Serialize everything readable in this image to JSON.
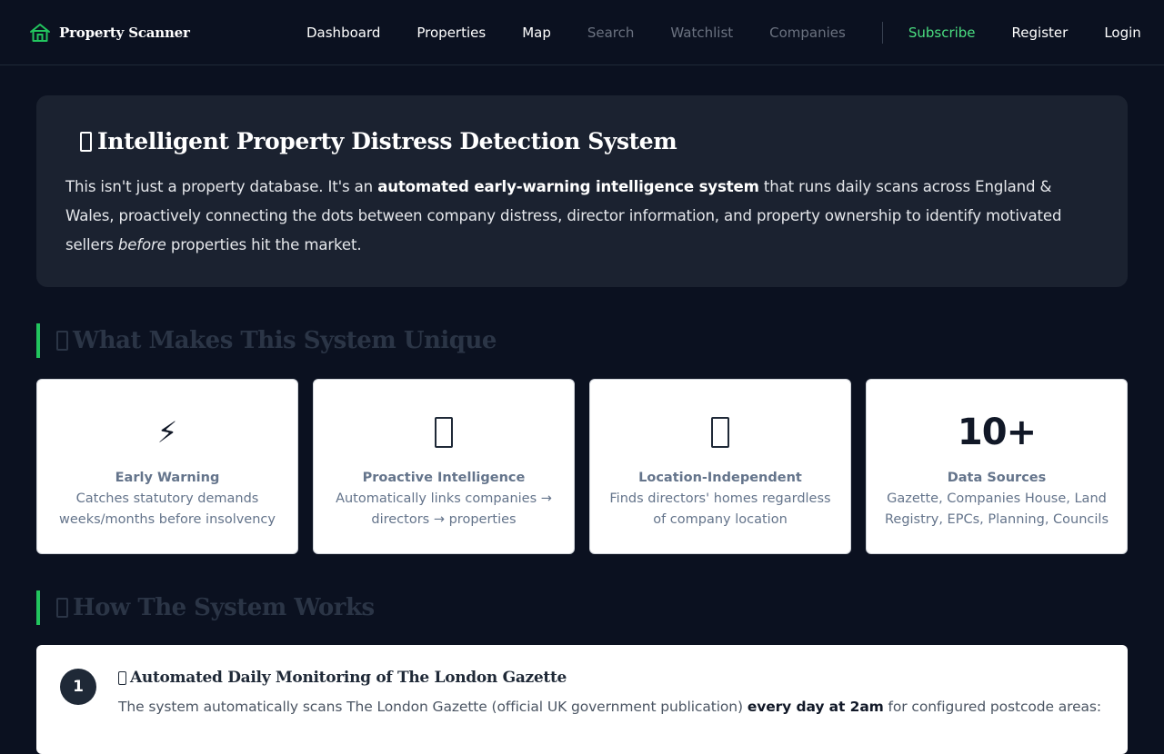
{
  "nav": {
    "brand": "Property Scanner",
    "brand_icon": "house-icon",
    "links": [
      {
        "label": "Dashboard"
      },
      {
        "label": "Properties"
      },
      {
        "label": "Map"
      },
      {
        "label": "Search"
      },
      {
        "label": "Watchlist"
      },
      {
        "label": "Companies"
      }
    ],
    "subscribe": "Subscribe",
    "register": "Register",
    "login": "Login"
  },
  "hero": {
    "title": "Intelligent Property Distress Detection System",
    "text_1": "This isn't just a property database. It's an ",
    "text_bold": "automated early-warning intelligence system",
    "text_2": " that runs daily scans across England & Wales, proactively connecting the dots between company distress, director information, and property ownership to identify motivated sellers ",
    "text_em": "before",
    "text_3": " properties hit the market."
  },
  "sections": {
    "unique": "What Makes This System Unique",
    "how": "How The System Works"
  },
  "cards": [
    {
      "icon": "lightning-icon",
      "glyph": "⚡",
      "title": "Early Warning",
      "desc": "Catches statutory demands weeks/months before insolvency"
    },
    {
      "icon": "emoji-icon",
      "title": "Proactive Intelligence",
      "desc": "Automatically links companies → directors → properties"
    },
    {
      "icon": "emoji-icon",
      "title": "Location-Independent",
      "desc": "Finds directors' homes regardless of company location"
    },
    {
      "stat": "10+",
      "title": "Data Sources",
      "desc": "Gazette, Companies House, Land Registry, EPCs, Planning, Councils"
    }
  ],
  "step": {
    "number": "1",
    "title": "Automated Daily Monitoring of The London Gazette",
    "text_1": "The system automatically scans The London Gazette (official UK government publication) ",
    "text_bold": "every day at 2am",
    "text_2": " for configured postcode areas:"
  },
  "colors": {
    "background": "#0b1120",
    "accent": "#22c55e",
    "subscribe": "#4ade80",
    "hero_bg": "#1b2230"
  }
}
